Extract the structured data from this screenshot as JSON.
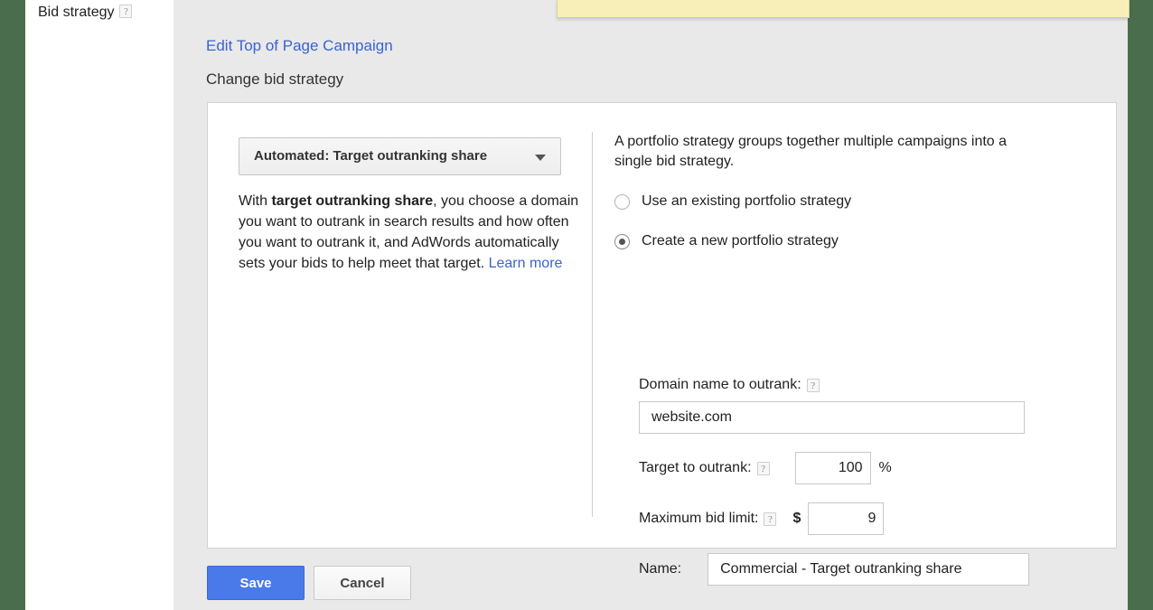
{
  "sidebar": {
    "label": "Bid strategy",
    "help_icon": "?"
  },
  "notice": {
    "present": true,
    "color": "#f8efb8"
  },
  "header": {
    "breadcrumb_link": "Edit Top of Page Campaign",
    "page_title": "Change bid strategy"
  },
  "strategy": {
    "selected": "Automated: Target outranking share",
    "caret_icon": "chevron-down-icon",
    "description_prefix": "With ",
    "description_bold": "target outranking share",
    "description_rest": ", you choose a domain you want to outrank in search results and how often you want to outrank it, and AdWords automatically sets your bids to help meet that target. ",
    "learn_more": "Learn more"
  },
  "portfolio": {
    "intro": "A portfolio strategy groups together multiple campaigns into a single bid strategy.",
    "options": [
      {
        "label": "Use an existing portfolio strategy",
        "selected": false
      },
      {
        "label": "Create a new portfolio strategy",
        "selected": true
      }
    ]
  },
  "fields": {
    "domain": {
      "label": "Domain name to outrank:",
      "help_icon": "?",
      "value": "website.com",
      "placeholder": ""
    },
    "target": {
      "label": "Target to outrank:",
      "help_icon": "?",
      "value": "100",
      "unit": "%"
    },
    "max_bid": {
      "label": "Maximum bid limit:",
      "help_icon": "?",
      "currency": "$",
      "value": "9"
    },
    "name": {
      "label": "Name:",
      "value": "Commercial - Target outranking share",
      "placeholder": ""
    }
  },
  "footer": {
    "save_label": "Save",
    "cancel_label": "Cancel"
  },
  "colors": {
    "page_edge": "#4a6e4d",
    "panel_bg": "#e9e9e9",
    "link": "#3b62d0",
    "primary_button": "#4a7aea",
    "notice_bar": "#f8efb8"
  }
}
